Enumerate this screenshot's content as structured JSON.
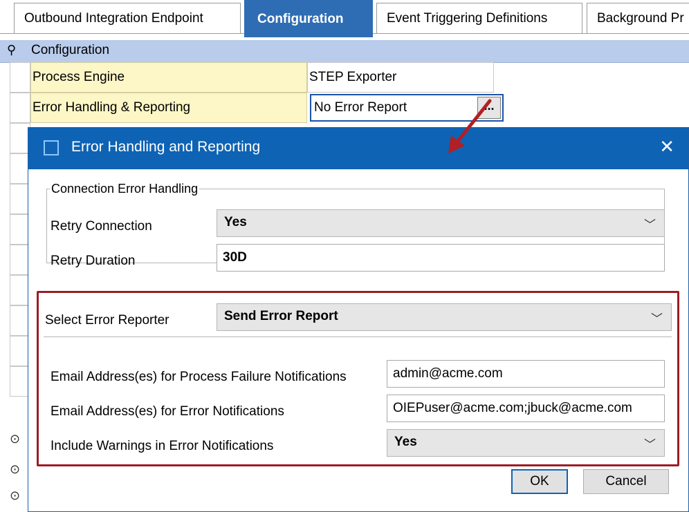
{
  "tabs": [
    {
      "label": "Outbound Integration Endpoint"
    },
    {
      "label": "Configuration"
    },
    {
      "label": "Event Triggering Definitions"
    },
    {
      "label": "Background Pr"
    }
  ],
  "section": {
    "title": "Configuration",
    "pin_icon": "pin-icon"
  },
  "properties": [
    {
      "label": "Process Engine",
      "value": "STEP Exporter"
    },
    {
      "label": "Error Handling & Reporting",
      "value": "No Error Report",
      "button": "..."
    }
  ],
  "dialog": {
    "title": "Error Handling and Reporting",
    "close_symbol": "✕",
    "connection_group": {
      "legend": "Connection Error Handling",
      "retry_connection": {
        "label": "Retry Connection",
        "value": "Yes"
      },
      "retry_duration": {
        "label": "Retry Duration",
        "value": "30D"
      }
    },
    "error_reporter": {
      "label": "Select Error Reporter",
      "value": "Send Error Report"
    },
    "process_failure_email": {
      "label": "Email Address(es) for Process Failure Notifications",
      "value": "admin@acme.com"
    },
    "error_email": {
      "label": "Email Address(es) for Error Notifications",
      "value": "OIEPuser@acme.com;jbuck@acme.com"
    },
    "include_warnings": {
      "label": "Include Warnings in Error Notifications",
      "value": "Yes"
    },
    "ok_label": "OK",
    "cancel_label": "Cancel"
  },
  "colors": {
    "accent": "#0e63b4",
    "active_tab": "#2e6db3",
    "highlight_border": "#9e1c24",
    "arrow": "#b21f24"
  }
}
